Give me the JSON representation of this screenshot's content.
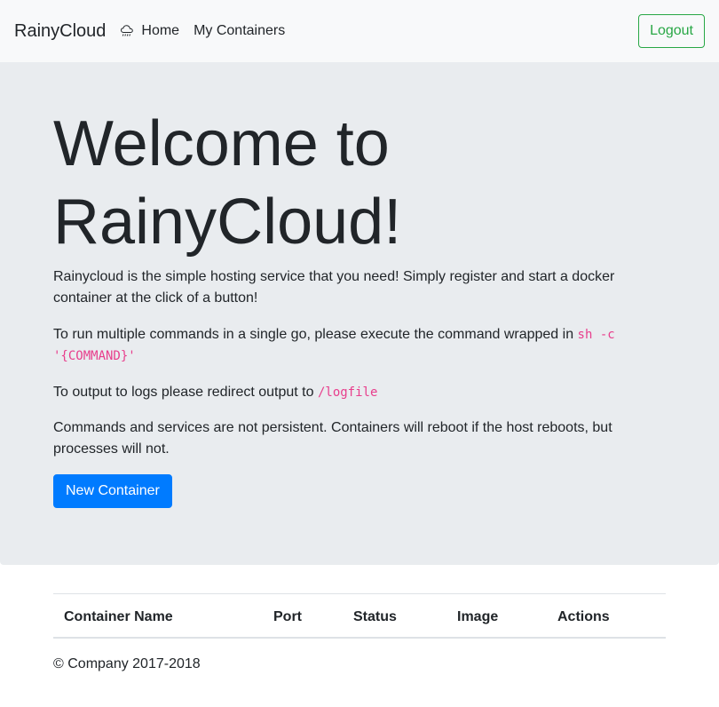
{
  "navbar": {
    "brand": "RainyCloud",
    "home_label": "Home",
    "containers_label": "My Containers",
    "logout_label": "Logout",
    "home_icon": "cloud-rain-icon"
  },
  "hero": {
    "title": "Welcome to RainyCloud!",
    "intro": "Rainycloud is the simple hosting service that you need! Simply register and start a docker container at the click of a button!",
    "multi_prefix": "To run multiple commands in a single go, please execute the command wrapped in ",
    "multi_code": "sh -c '{COMMAND}'",
    "logs_prefix": "To output to logs please redirect output to ",
    "logs_code": "/logfile",
    "persistence": "Commands and services are not persistent. Containers will reboot if the host reboots, but processes will not.",
    "new_container_label": "New Container"
  },
  "table": {
    "headers": [
      "Container Name",
      "Port",
      "Status",
      "Image",
      "Actions"
    ]
  },
  "footer": {
    "copyright": "© Company 2017-2018"
  },
  "colors": {
    "primary": "#007bff",
    "success": "#28a745",
    "code": "#e83e8c",
    "jumbotron_bg": "#e9ecef",
    "navbar_bg": "#f8f9fa"
  }
}
